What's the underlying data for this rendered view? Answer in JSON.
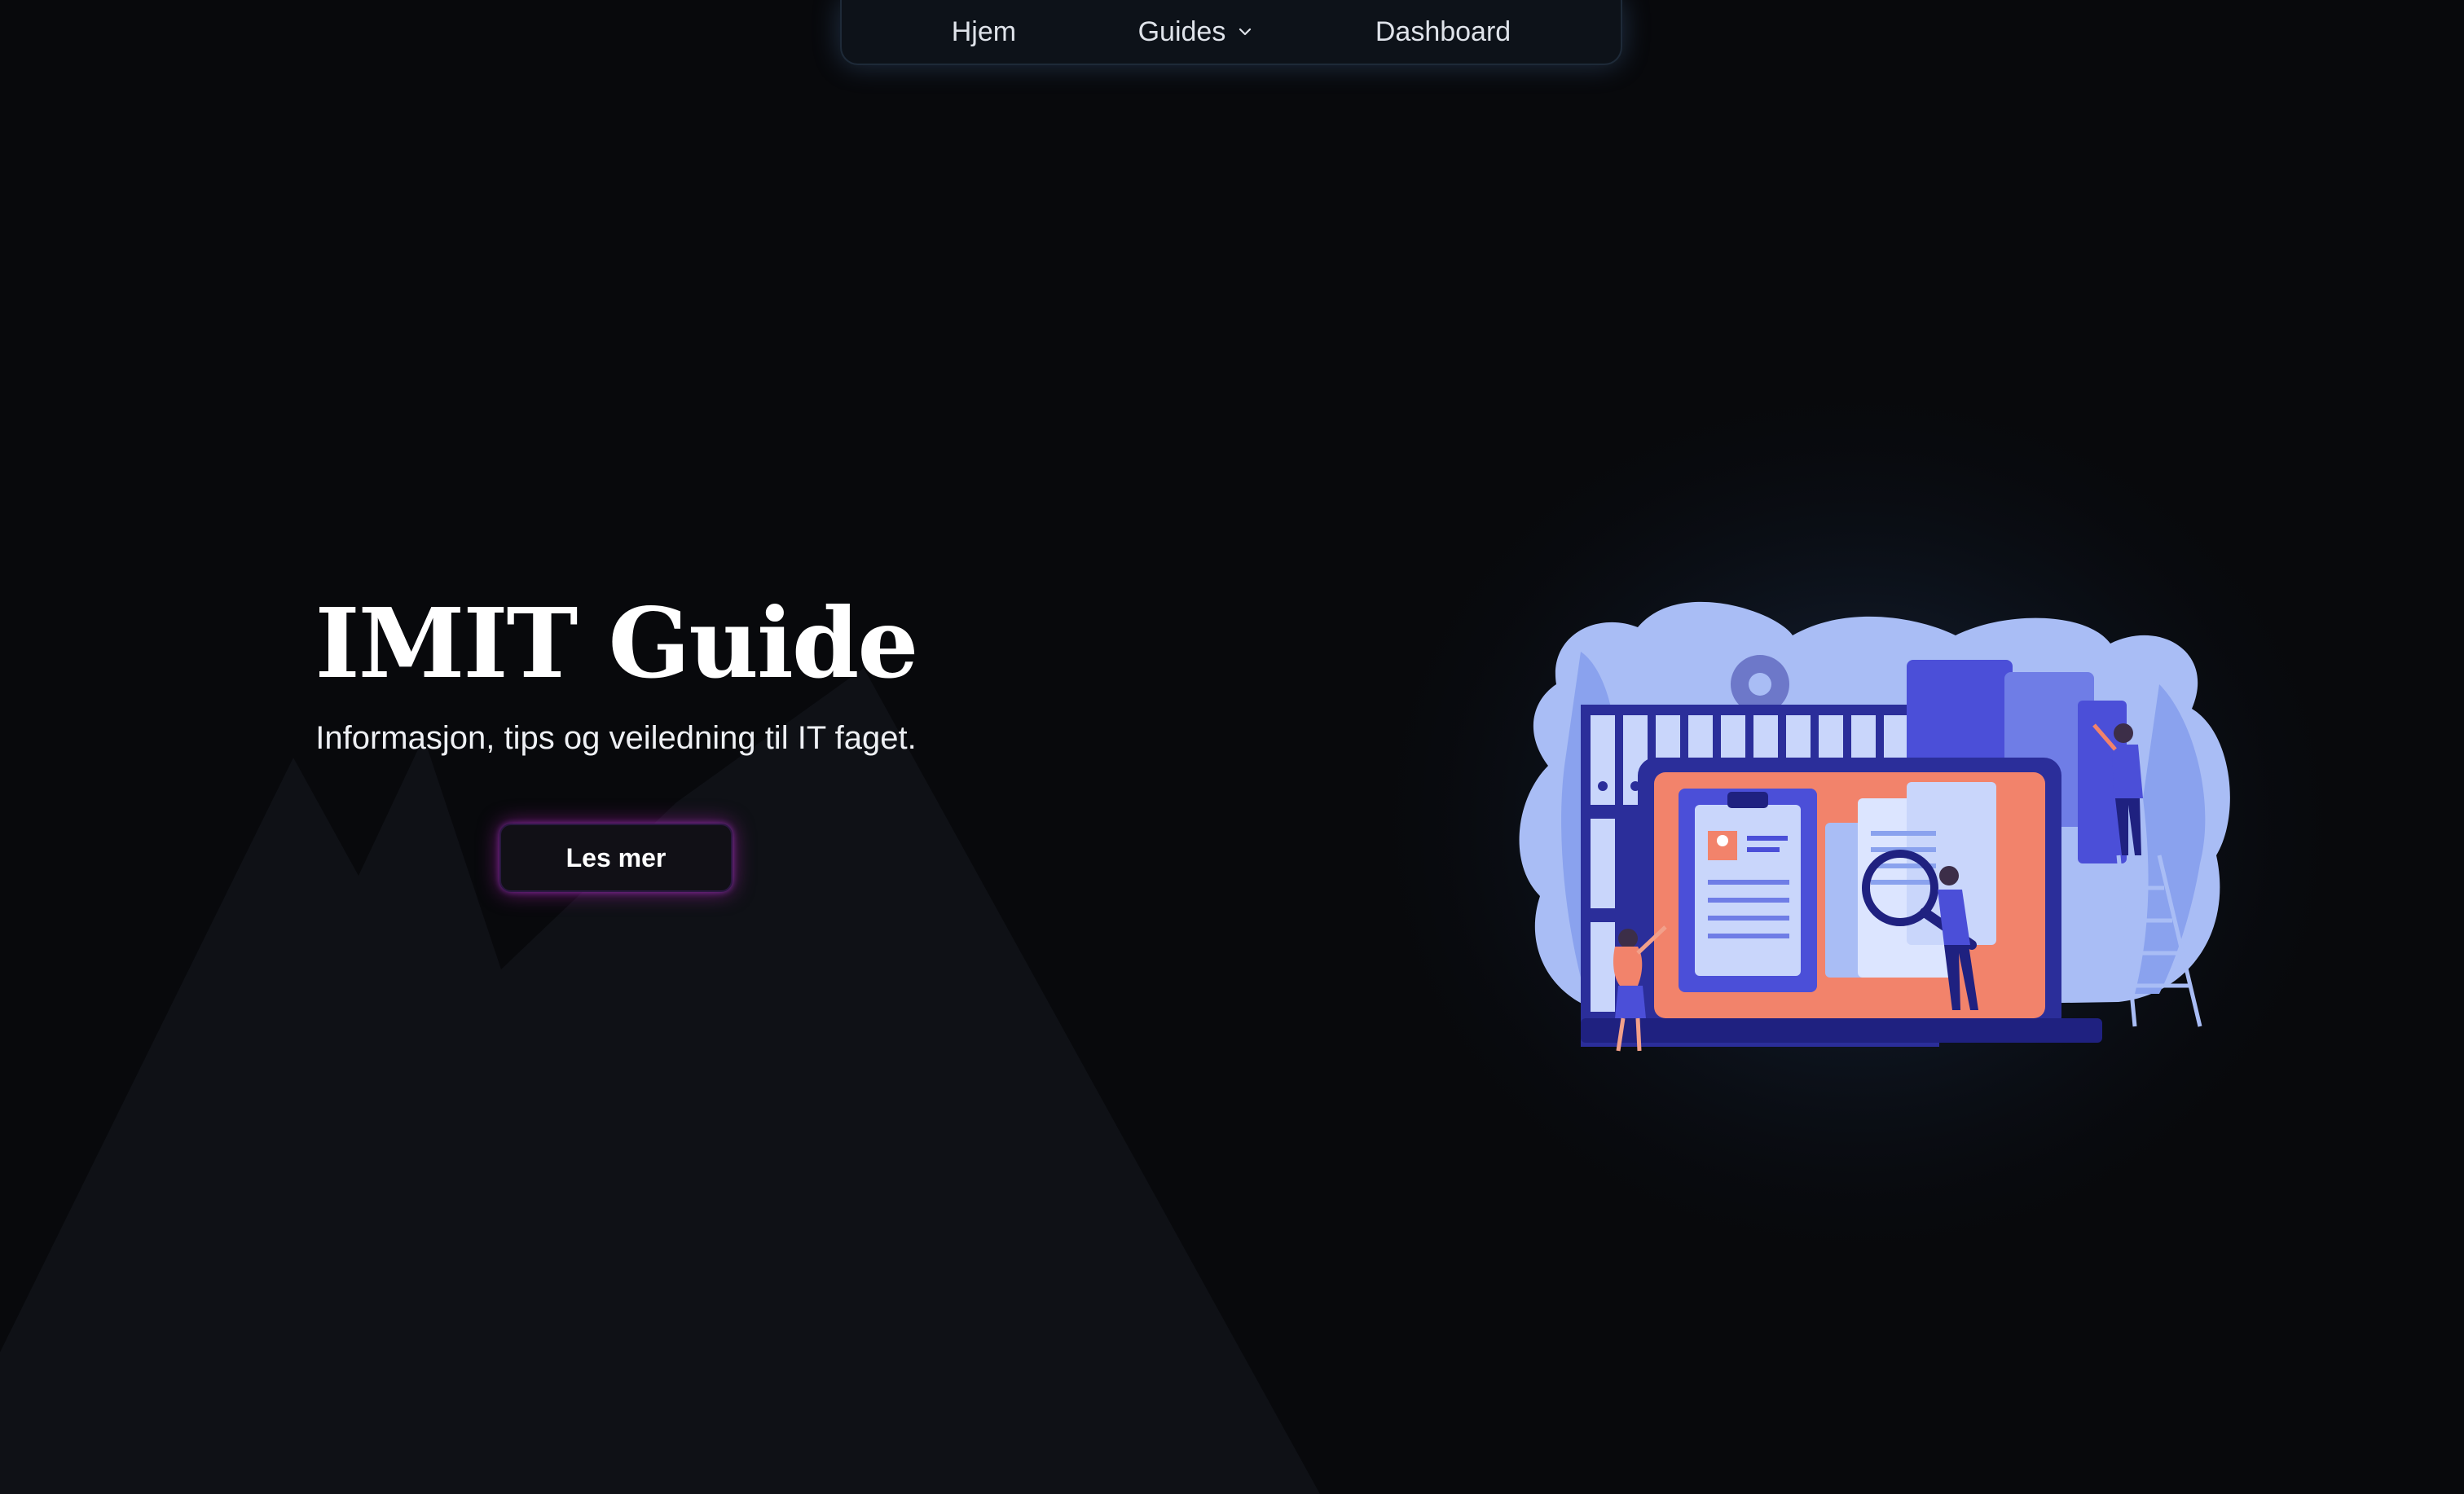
{
  "nav": {
    "items": [
      {
        "label": "Hjem"
      },
      {
        "label": "Guides"
      },
      {
        "label": "Dashboard"
      }
    ]
  },
  "hero": {
    "title": "IMIT Guide",
    "subtitle": "Informasjon, tips og veiledning til IT faget.",
    "button_label": "Les mer"
  },
  "colors": {
    "background": "#08090c",
    "mountain": "#0f1116",
    "button_glow": "#c828c8",
    "illustration_primary": "#4b4fd8",
    "illustration_accent": "#f2836b"
  },
  "icons": {
    "guides_dropdown": "chevron-down-icon"
  }
}
